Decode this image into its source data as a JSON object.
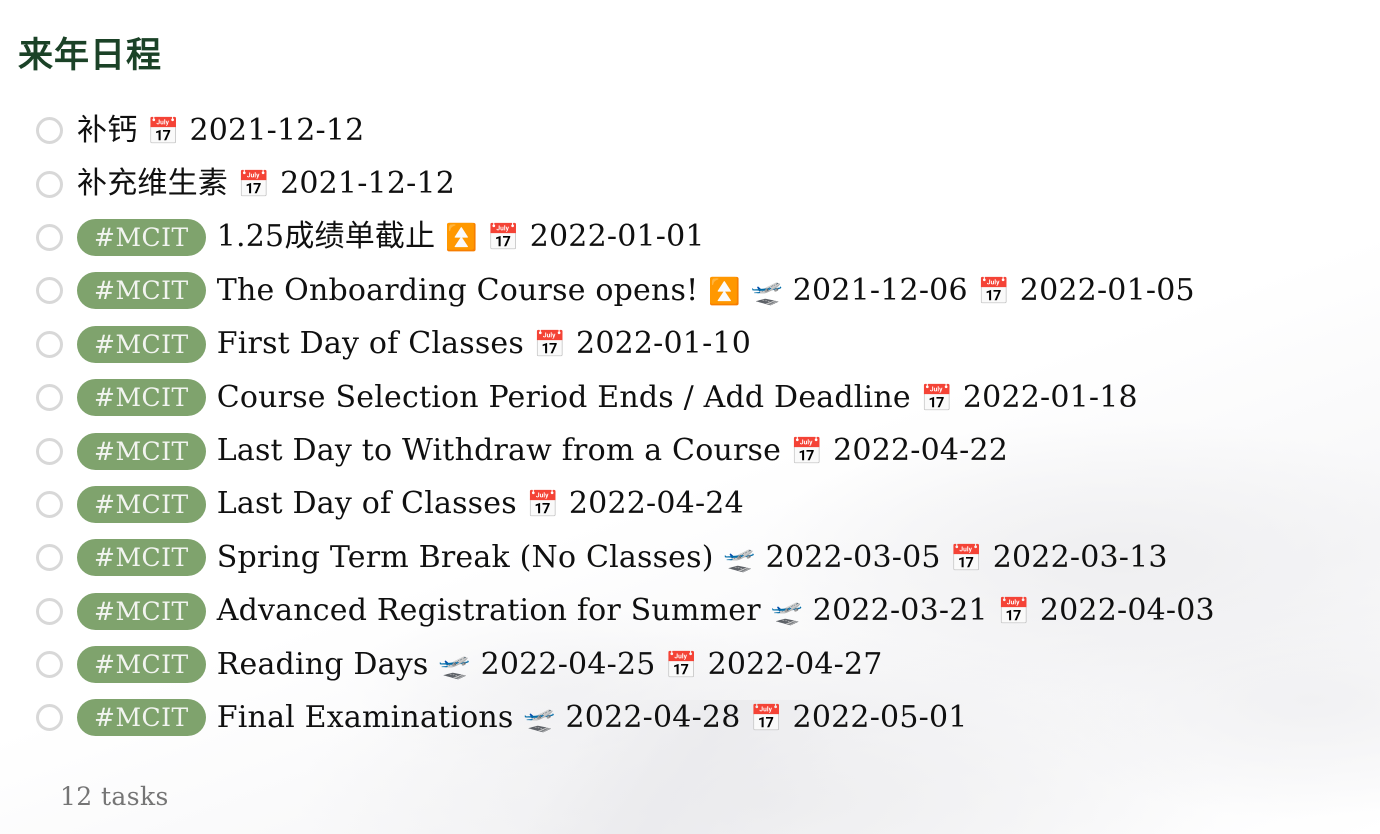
{
  "header": {
    "title": "来年日程",
    "title_color": "#1b4227"
  },
  "theme": {
    "tag_background": "#7fa36d",
    "tag_text_color": "#f2f4f0",
    "checkbox_border": "#d8d8d8",
    "body_text_color": "#101010",
    "footer_text_color": "#757575",
    "page_background": "#ffffff"
  },
  "icons": {
    "checkbox": "unchecked-circle-icon",
    "calendar": "calendar-icon",
    "calendar_glyph": "📅",
    "up_arrow": "fast-up-button-icon",
    "up_arrow_glyph": "⏫",
    "departure": "airplane-departure-icon",
    "departure_glyph": "🛫"
  },
  "tasks": [
    {
      "checkbox": "unchecked",
      "tag": null,
      "title": "补钙",
      "icons": [
        "📅"
      ],
      "dates": [
        "2021-12-12"
      ],
      "text": "补钙 📅 2021-12-12"
    },
    {
      "checkbox": "unchecked",
      "tag": null,
      "title": "补充维生素",
      "icons": [
        "📅"
      ],
      "dates": [
        "2021-12-12"
      ],
      "text": "补充维生素 📅 2021-12-12"
    },
    {
      "checkbox": "unchecked",
      "tag": "#MCIT",
      "title": "1.25成绩单截止",
      "icons": [
        "⏫",
        "📅"
      ],
      "dates": [
        "2022-01-01"
      ],
      "text": "1.25成绩单截止 ⏫ 📅 2022-01-01"
    },
    {
      "checkbox": "unchecked",
      "tag": "#MCIT",
      "title": "The Onboarding Course opens!",
      "icons": [
        "⏫",
        "🛫",
        "📅"
      ],
      "dates": [
        "2021-12-06",
        "2022-01-05"
      ],
      "text": "The Onboarding Course opens! ⏫ 🛫 2021-12-06 📅 2022-01-05"
    },
    {
      "checkbox": "unchecked",
      "tag": "#MCIT",
      "title": "First Day of Classes",
      "icons": [
        "📅"
      ],
      "dates": [
        "2022-01-10"
      ],
      "text": "First Day of Classes 📅 2022-01-10"
    },
    {
      "checkbox": "unchecked",
      "tag": "#MCIT",
      "title": "Course Selection Period Ends / Add Deadline",
      "icons": [
        "📅"
      ],
      "dates": [
        "2022-01-18"
      ],
      "text": "Course Selection Period Ends / Add Deadline 📅 2022-01-18"
    },
    {
      "checkbox": "unchecked",
      "tag": "#MCIT",
      "title": "Last Day to Withdraw from a Course",
      "icons": [
        "📅"
      ],
      "dates": [
        "2022-04-22"
      ],
      "text": "Last Day to Withdraw from a Course 📅 2022-04-22"
    },
    {
      "checkbox": "unchecked",
      "tag": "#MCIT",
      "title": "Last Day of Classes",
      "icons": [
        "📅"
      ],
      "dates": [
        "2022-04-24"
      ],
      "text": "Last Day of Classes 📅 2022-04-24"
    },
    {
      "checkbox": "unchecked",
      "tag": "#MCIT",
      "title": "Spring Term Break (No Classes)",
      "icons": [
        "🛫",
        "📅"
      ],
      "dates": [
        "2022-03-05",
        "2022-03-13"
      ],
      "text": "Spring Term Break (No Classes) 🛫 2022-03-05 📅 2022-03-13"
    },
    {
      "checkbox": "unchecked",
      "tag": "#MCIT",
      "title": "Advanced Registration for Summer",
      "icons": [
        "🛫",
        "📅"
      ],
      "dates": [
        "2022-03-21",
        "2022-04-03"
      ],
      "text": "Advanced Registration for Summer 🛫 2022-03-21 📅 2022-04-03"
    },
    {
      "checkbox": "unchecked",
      "tag": "#MCIT",
      "title": "Reading Days",
      "icons": [
        "🛫",
        "📅"
      ],
      "dates": [
        "2022-04-25",
        "2022-04-27"
      ],
      "text": "Reading Days 🛫 2022-04-25 📅 2022-04-27"
    },
    {
      "checkbox": "unchecked",
      "tag": "#MCIT",
      "title": "Final Examinations",
      "icons": [
        "🛫",
        "📅"
      ],
      "dates": [
        "2022-04-28",
        "2022-05-01"
      ],
      "text": "Final Examinations 🛫 2022-04-28 📅 2022-05-01"
    }
  ],
  "footer": {
    "count_label": "12 tasks"
  }
}
